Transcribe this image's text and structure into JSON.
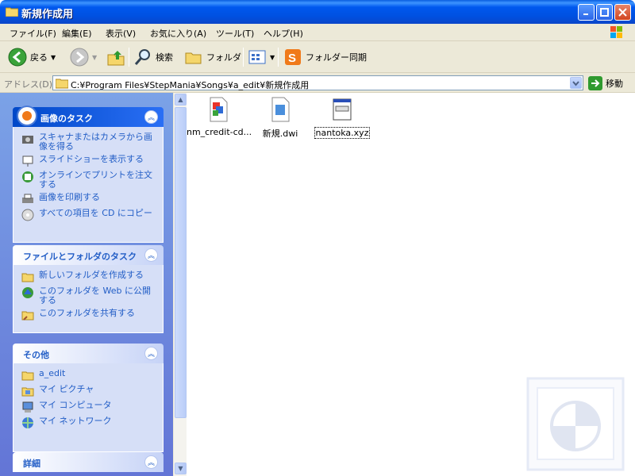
{
  "window": {
    "title": "新規作成用"
  },
  "menu": [
    "ファイル(F)",
    "編集(E)",
    "表示(V)",
    "お気に入り(A)",
    "ツール(T)",
    "ヘルプ(H)"
  ],
  "toolbar": {
    "back": "戻る",
    "search": "検索",
    "folders": "フォルダ",
    "sync": "フォルダー同期"
  },
  "address": {
    "label": "アドレス(D)",
    "path": "C:¥Program Files¥StepMania¥Songs¥a_edit¥新規作成用",
    "go": "移動"
  },
  "panels": {
    "picture_tasks": {
      "title": "画像のタスク",
      "items": [
        "スキャナまたはカメラから画像を得る",
        "スライドショーを表示する",
        "オンラインでプリントを注文する",
        "画像を印刷する",
        "すべての項目を CD にコピー"
      ]
    },
    "file_tasks": {
      "title": "ファイルとフォルダのタスク",
      "items": [
        "新しいフォルダを作成する",
        "このフォルダを Web に公開する",
        "このフォルダを共有する"
      ]
    },
    "other_places": {
      "title": "その他",
      "items": [
        "a_edit",
        "マイ ピクチャ",
        "マイ コンピュータ",
        "マイ ネットワーク"
      ]
    },
    "details": {
      "title": "詳細"
    }
  },
  "files": [
    {
      "name": "nm_credit-cd...",
      "icon": "image-file-icon"
    },
    {
      "name": "新規.dwi",
      "icon": "dwi-file-icon"
    },
    {
      "name": "nantoka.xyz",
      "icon": "generic-file-icon",
      "selected": true
    }
  ],
  "colors": {
    "titlebar": "#0058ee",
    "taskpane": "#7ba2e7",
    "link": "#215dc6"
  }
}
